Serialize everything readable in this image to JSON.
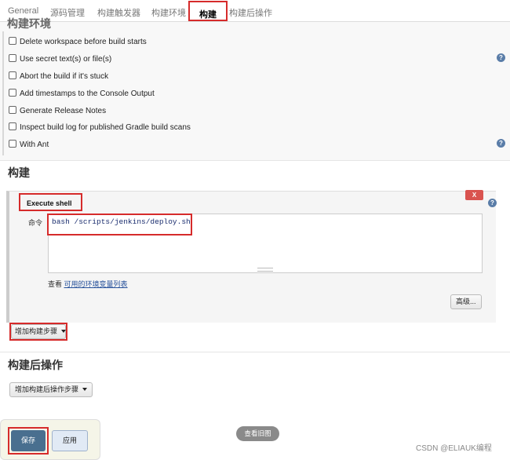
{
  "tabs": [
    "General",
    "源码管理",
    "构建触发器",
    "构建环境",
    "构建",
    "构建后操作"
  ],
  "build_env": {
    "title_partial": "构建环境",
    "options": [
      "Delete workspace before build starts",
      "Use secret text(s) or file(s)",
      "Abort the build if it's stuck",
      "Add timestamps to the Console Output",
      "Generate Release Notes",
      "Inspect build log for published Gradle build scans",
      "With Ant"
    ]
  },
  "build": {
    "title": "构建",
    "step_title": "Execute shell",
    "delete_label": "X",
    "command_label": "命令",
    "command": "bash /scripts/jenkins/deploy.sh",
    "env_vars_prefix": "查看 ",
    "env_vars_link": "可用的环境变量列表",
    "advanced_label": "高级...",
    "add_step_label": "增加构建步骤"
  },
  "post_build": {
    "title": "构建后操作",
    "add_step_label": "增加构建后操作步骤"
  },
  "footer": {
    "save_label": "保存",
    "apply_label": "应用",
    "view_old_label": "查看旧图"
  },
  "watermark": "CSDN @ELIAUK编程",
  "icons": {
    "help": "help-icon",
    "dropdown": "caret-down-icon"
  },
  "colors": {
    "highlight": "#d62b2b",
    "save": "#496f8f",
    "danger": "#d9534f",
    "link": "#25509a"
  }
}
